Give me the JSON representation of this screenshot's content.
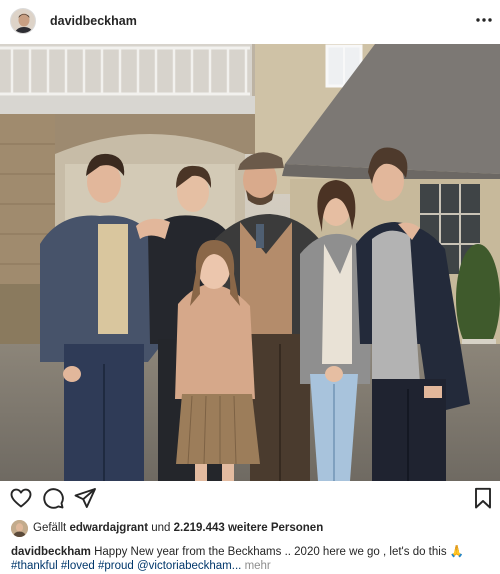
{
  "header": {
    "username": "davidbeckham",
    "more_icon": "ellipsis-icon"
  },
  "photo": {
    "subject": "family-group-photo"
  },
  "actions": {
    "like_icon": "heart-icon",
    "comment_icon": "comment-bubble-icon",
    "share_icon": "paper-plane-icon",
    "save_icon": "bookmark-icon"
  },
  "likes": {
    "prefix": "Gefällt ",
    "liker": "edwardajgrant",
    "middle": " und ",
    "count": "2.219.443",
    "suffix": " weitere Personen"
  },
  "caption": {
    "username": "davidbeckham",
    "text": " Happy New year from the Beckhams .. 2020 here we go , let's do this ",
    "emoji": "🙏",
    "hashtags": [
      "#thankful",
      "#loved",
      "#proud"
    ],
    "mention": "@victoriabeckham...",
    "more": "mehr"
  }
}
